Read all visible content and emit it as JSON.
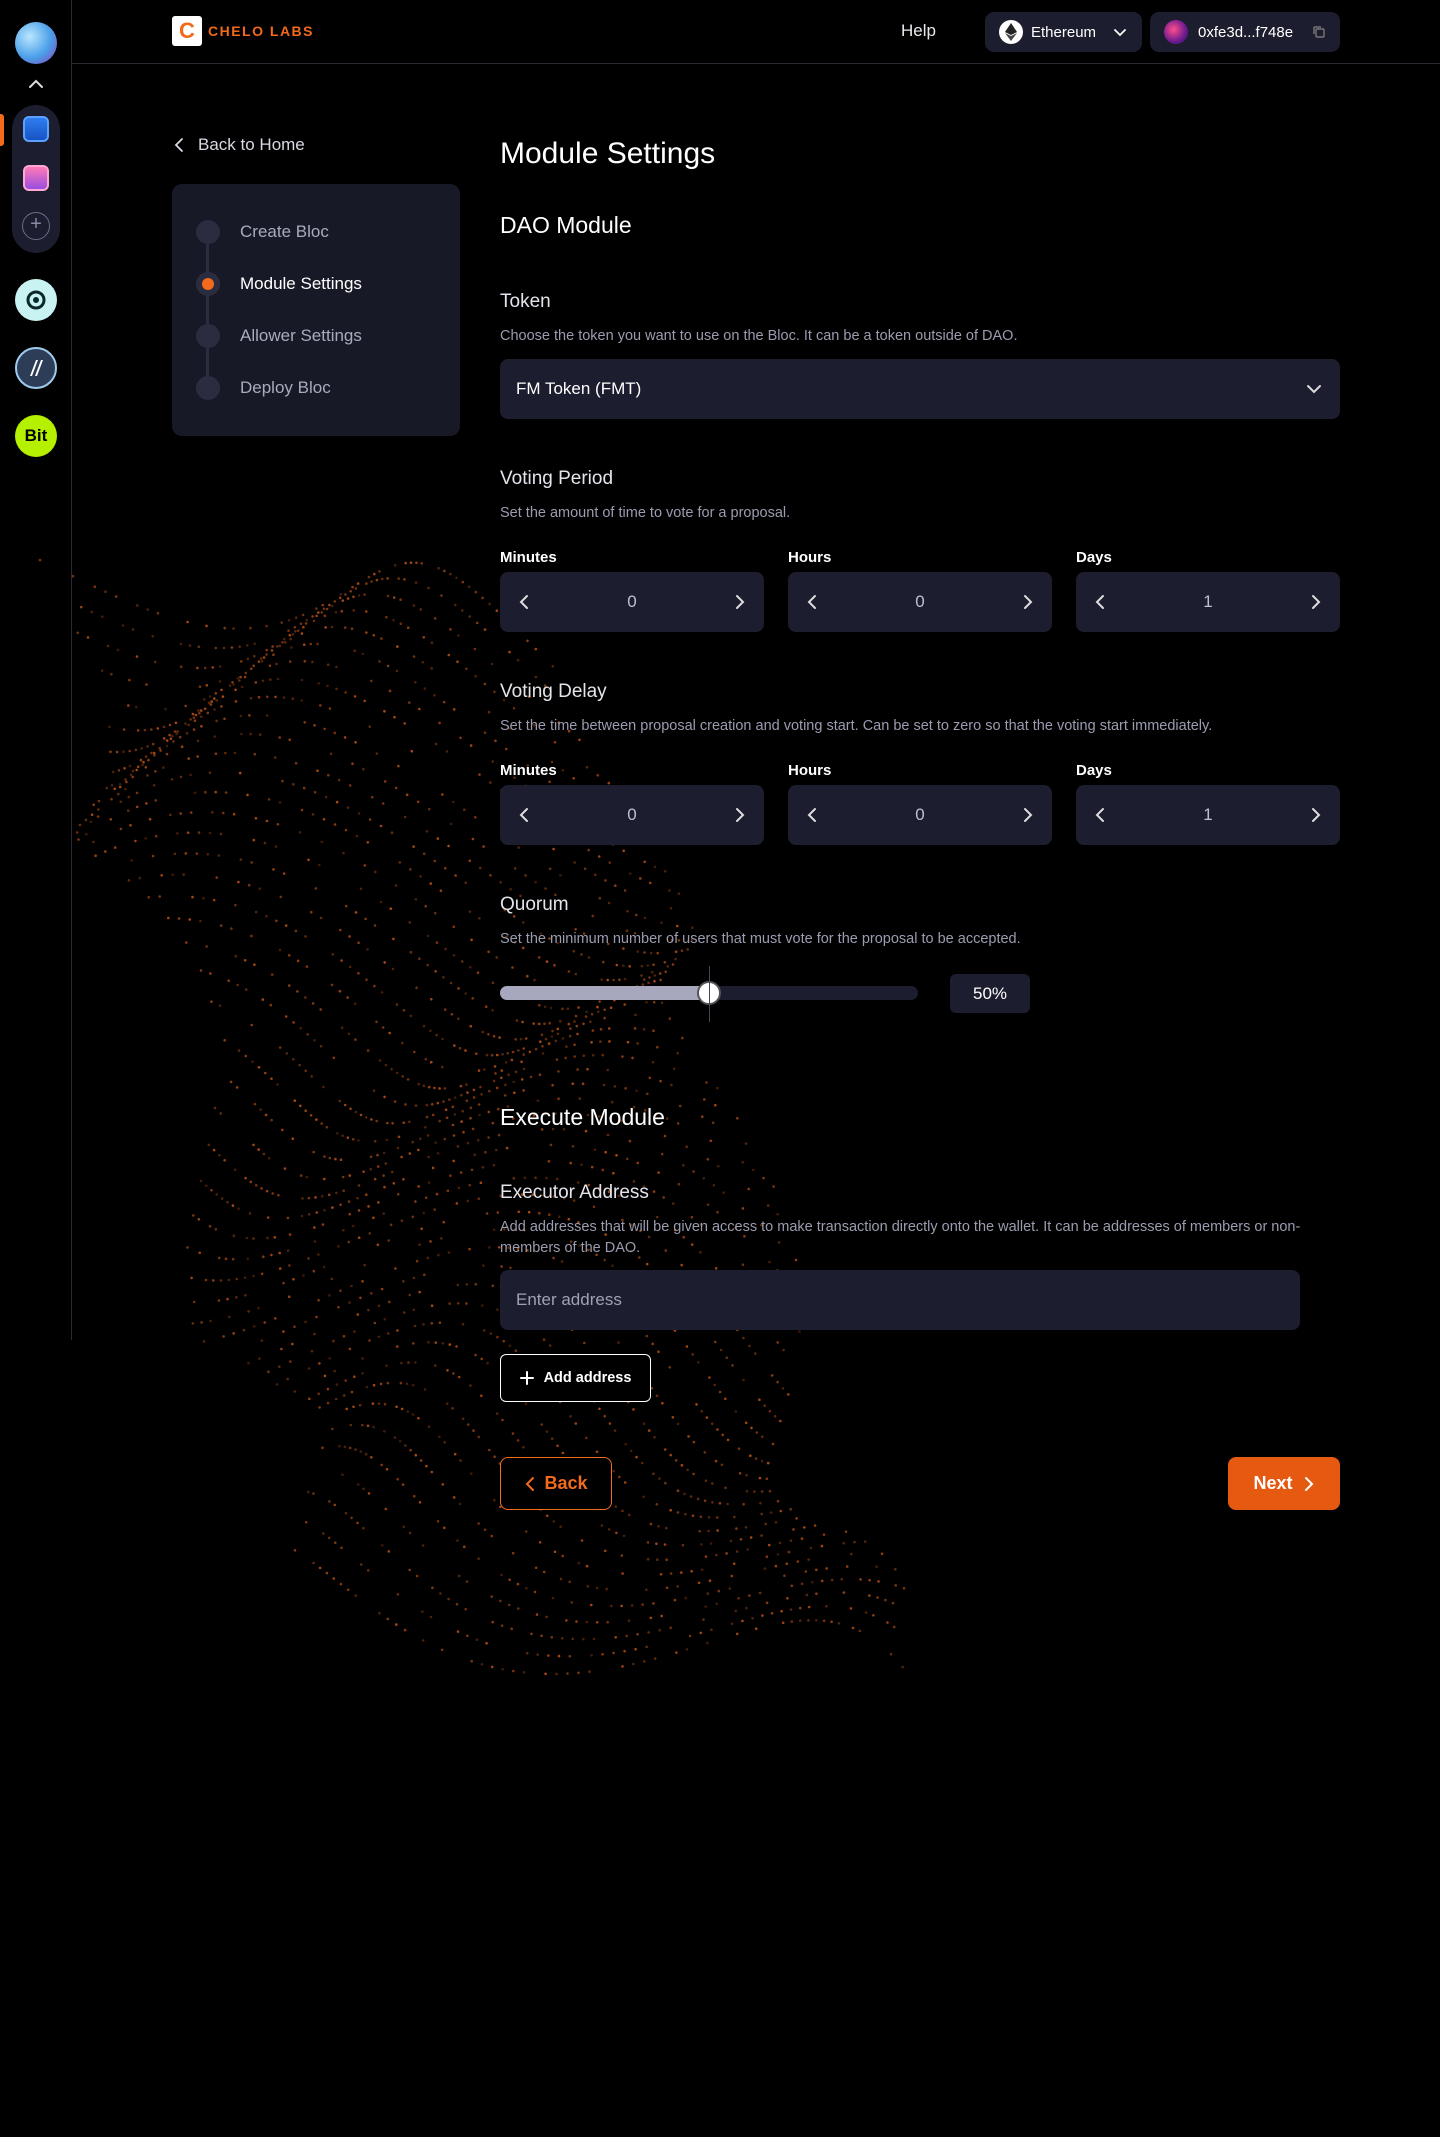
{
  "header": {
    "brand_letter": "C",
    "brand_name": "CHELO LABS",
    "help_label": "Help",
    "network_label": "Ethereum",
    "wallet_label": "0xfe3d...f748e"
  },
  "rail": {
    "coin_bit_label": "Bit"
  },
  "sidebar": {
    "back_label": "Back to Home",
    "steps": [
      {
        "label": "Create Bloc",
        "active": false
      },
      {
        "label": "Module Settings",
        "active": true
      },
      {
        "label": "Allower Settings",
        "active": false
      },
      {
        "label": "Deploy Bloc",
        "active": false
      }
    ]
  },
  "main": {
    "title": "Module Settings",
    "dao_section": "DAO Module",
    "token": {
      "label": "Token",
      "help": "Choose the token you want to use on the Bloc. It can be a token outside of DAO.",
      "selected": "FM Token (FMT)"
    },
    "voting_period": {
      "label": "Voting Period",
      "help": "Set the amount of time to vote for a proposal.",
      "units": [
        {
          "label": "Minutes",
          "value": "0"
        },
        {
          "label": "Hours",
          "value": "0"
        },
        {
          "label": "Days",
          "value": "1"
        }
      ]
    },
    "voting_delay": {
      "label": "Voting Delay",
      "help": "Set the time between proposal creation and voting start. Can be set to zero so that the voting start immediately.",
      "units": [
        {
          "label": "Minutes",
          "value": "0"
        },
        {
          "label": "Hours",
          "value": "0"
        },
        {
          "label": "Days",
          "value": "1"
        }
      ]
    },
    "quorum": {
      "label": "Quorum",
      "help": "Set the minimum number of users that must vote for the proposal to be accepted.",
      "value_percent": 50,
      "value_label": "50%"
    },
    "execute_section": "Execute Module",
    "executor": {
      "label": "Executor Address",
      "help": "Add addresses that will be given access to make transaction directly onto the wallet. It can be addresses of members or non-members of the DAO.",
      "placeholder": "Enter address",
      "add_label": "Add address"
    },
    "back_label": "Back",
    "next_label": "Next"
  },
  "colors": {
    "accent": "#f26a1b",
    "panel": "#1c1d2e",
    "background": "#000000"
  }
}
